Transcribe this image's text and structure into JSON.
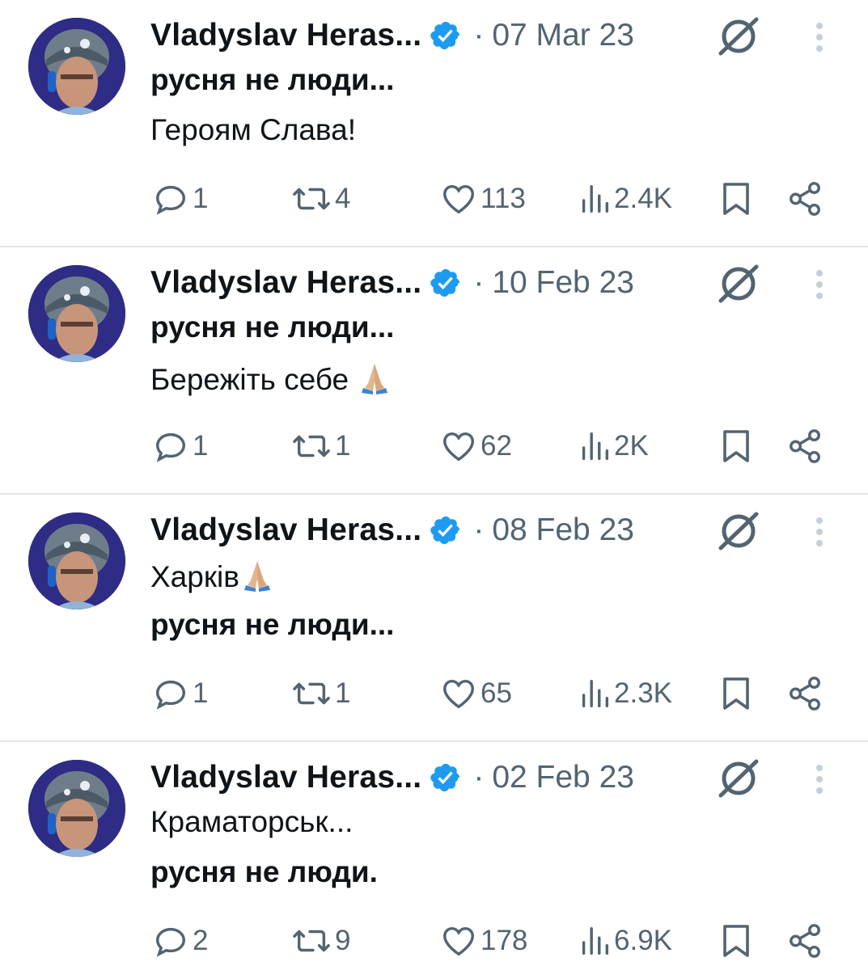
{
  "tweets": [
    {
      "author": "Vladyslav Heras...",
      "date": "07 Mar 23",
      "line1": "русня не люди...",
      "line1_style": "bold",
      "line2": "Героям Слава!",
      "line2_style": "normal",
      "line2_emoji": "",
      "replies": "1",
      "reposts": "4",
      "likes": "113",
      "views": "2.4K"
    },
    {
      "author": "Vladyslav Heras...",
      "date": "10 Feb 23",
      "line1": "русня не люди...",
      "line1_style": "bold",
      "line2": "Бережіть себе ",
      "line2_style": "normal",
      "line2_emoji": "folded-hands",
      "replies": "1",
      "reposts": "1",
      "likes": "62",
      "views": "2K"
    },
    {
      "author": "Vladyslav Heras...",
      "date": "08 Feb 23",
      "line1": "Харків",
      "line1_style": "normal",
      "line1_emoji": "folded-hands",
      "line2": "русня не люди...",
      "line2_style": "bold",
      "replies": "1",
      "reposts": "1",
      "likes": "65",
      "views": "2.3K"
    },
    {
      "author": "Vladyslav Heras...",
      "date": "02 Feb 23",
      "line1": "Краматорськ...",
      "line1_style": "normal",
      "line2": "русня не люди.",
      "line2_style": "bold",
      "replies": "2",
      "reposts": "9",
      "likes": "178",
      "views": "6.9K"
    }
  ],
  "separator": "·",
  "colors": {
    "text": "#0f1419",
    "secondary": "#536471",
    "verified": "#1d9bf0",
    "divider": "#e3e6e8"
  },
  "icons": [
    "avatar",
    "verified-badge-icon",
    "grok-icon",
    "more-icon",
    "reply-icon",
    "repost-icon",
    "like-icon",
    "views-icon",
    "bookmark-icon",
    "share-icon",
    "folded-hands-emoji"
  ]
}
